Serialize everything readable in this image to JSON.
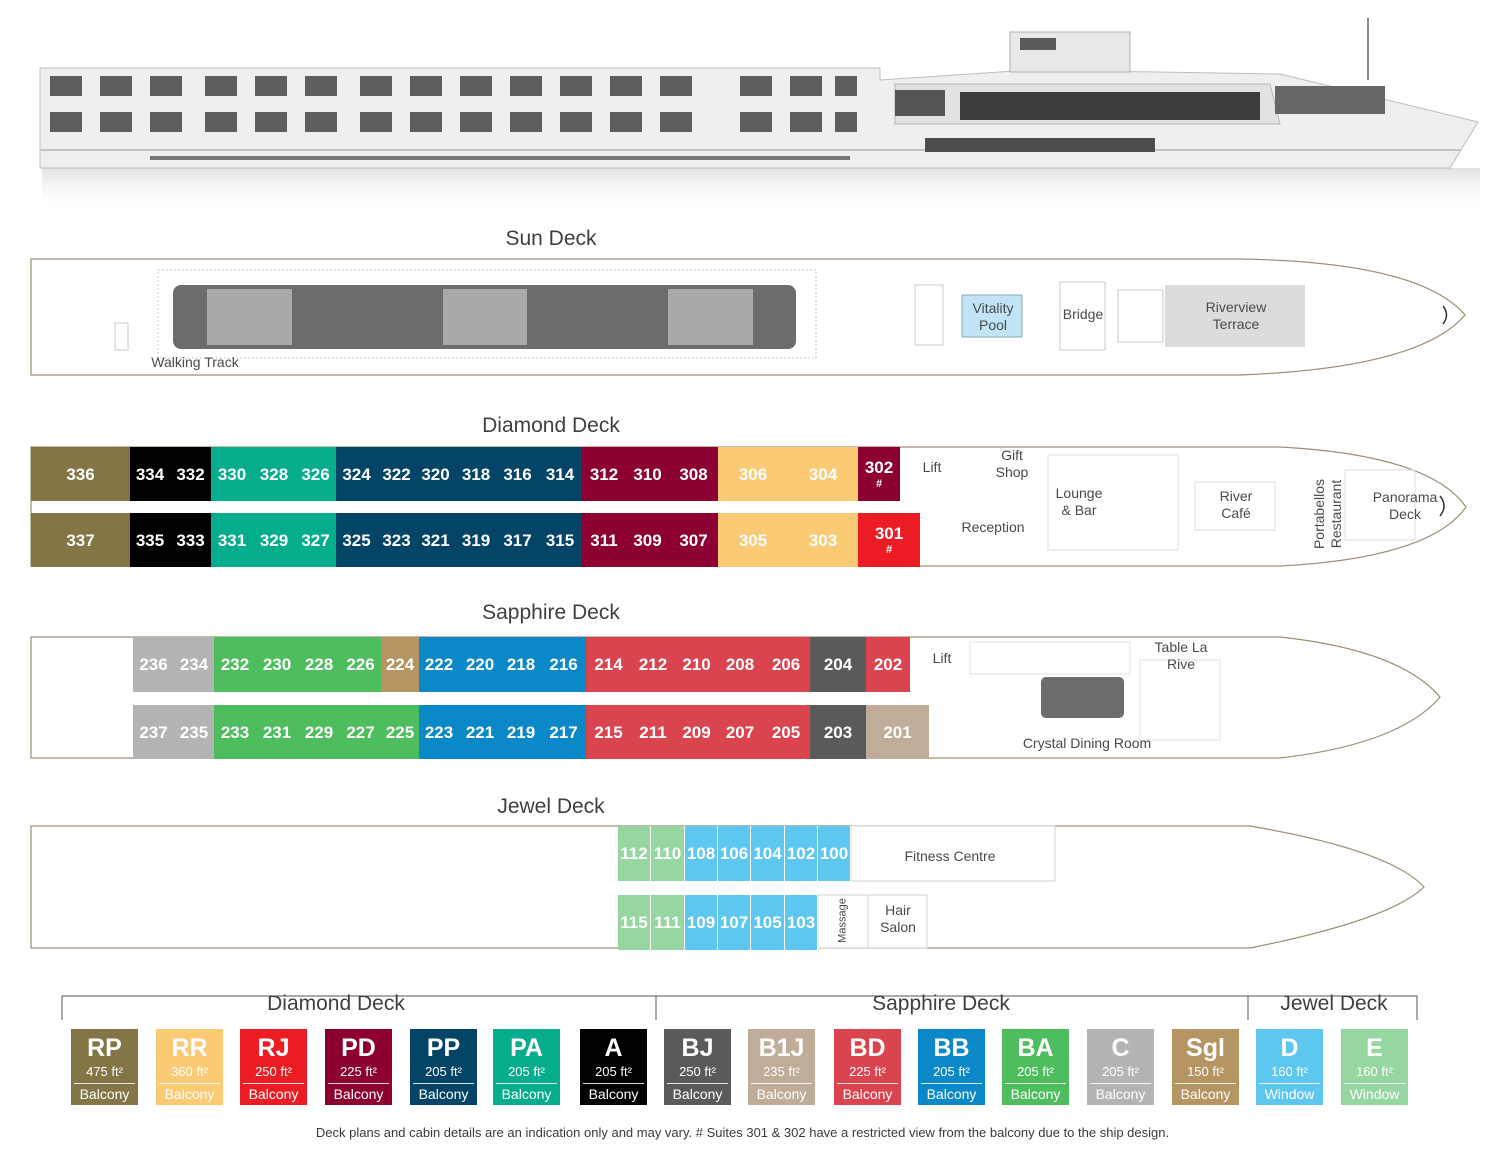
{
  "decks": {
    "sun": {
      "title": "Sun Deck",
      "walking_track": "Walking Track",
      "vitality_pool": "Vitality Pool",
      "bridge": "Bridge",
      "riverview_terrace": "Riverview Terrace"
    },
    "diamond": {
      "title": "Diamond Deck",
      "lift": "Lift",
      "gift_shop": "Gift Shop",
      "reception": "Reception",
      "lounge_bar": "Lounge & Bar",
      "river_cafe": "River Café",
      "portabellos": "Portabellos Restaurant",
      "panorama_deck": "Panorama Deck",
      "top_cabins": [
        {
          "n": "336",
          "cat": "RP"
        },
        {
          "n": "334",
          "cat": "A"
        },
        {
          "n": "332",
          "cat": "A"
        },
        {
          "n": "330",
          "cat": "PA"
        },
        {
          "n": "328",
          "cat": "PA"
        },
        {
          "n": "326",
          "cat": "PA"
        },
        {
          "n": "324",
          "cat": "PP"
        },
        {
          "n": "322",
          "cat": "PP"
        },
        {
          "n": "320",
          "cat": "PP"
        },
        {
          "n": "318",
          "cat": "PP"
        },
        {
          "n": "316",
          "cat": "PP"
        },
        {
          "n": "314",
          "cat": "PP"
        },
        {
          "n": "312",
          "cat": "PD"
        },
        {
          "n": "310",
          "cat": "PD"
        },
        {
          "n": "308",
          "cat": "PD"
        },
        {
          "n": "306",
          "cat": "RR"
        },
        {
          "n": "304",
          "cat": "RR"
        },
        {
          "n": "302",
          "cat": "PD",
          "mark": "#"
        }
      ],
      "bottom_cabins": [
        {
          "n": "337",
          "cat": "RP"
        },
        {
          "n": "335",
          "cat": "A"
        },
        {
          "n": "333",
          "cat": "A"
        },
        {
          "n": "331",
          "cat": "PA"
        },
        {
          "n": "329",
          "cat": "PA"
        },
        {
          "n": "327",
          "cat": "PA"
        },
        {
          "n": "325",
          "cat": "PP"
        },
        {
          "n": "323",
          "cat": "PP"
        },
        {
          "n": "321",
          "cat": "PP"
        },
        {
          "n": "319",
          "cat": "PP"
        },
        {
          "n": "317",
          "cat": "PP"
        },
        {
          "n": "315",
          "cat": "PP"
        },
        {
          "n": "311",
          "cat": "PD"
        },
        {
          "n": "309",
          "cat": "PD"
        },
        {
          "n": "307",
          "cat": "PD"
        },
        {
          "n": "305",
          "cat": "RR"
        },
        {
          "n": "303",
          "cat": "RR"
        },
        {
          "n": "301",
          "cat": "RJ",
          "mark": "#"
        }
      ]
    },
    "sapphire": {
      "title": "Sapphire Deck",
      "lift": "Lift",
      "table_la_rive": "Table La Rive",
      "crystal_dining": "Crystal Dining Room",
      "top_cabins": [
        {
          "n": "236",
          "cat": "C"
        },
        {
          "n": "234",
          "cat": "C"
        },
        {
          "n": "232",
          "cat": "BA"
        },
        {
          "n": "230",
          "cat": "BA"
        },
        {
          "n": "228",
          "cat": "BA"
        },
        {
          "n": "226",
          "cat": "BA"
        },
        {
          "n": "224",
          "cat": "Sgl"
        },
        {
          "n": "222",
          "cat": "BB"
        },
        {
          "n": "220",
          "cat": "BB"
        },
        {
          "n": "218",
          "cat": "BB"
        },
        {
          "n": "216",
          "cat": "BB"
        },
        {
          "n": "214",
          "cat": "BD"
        },
        {
          "n": "212",
          "cat": "BD"
        },
        {
          "n": "210",
          "cat": "BD"
        },
        {
          "n": "208",
          "cat": "BD"
        },
        {
          "n": "206",
          "cat": "BD"
        },
        {
          "n": "204",
          "cat": "BJ"
        },
        {
          "n": "202",
          "cat": "BD"
        }
      ],
      "bottom_cabins": [
        {
          "n": "237",
          "cat": "C"
        },
        {
          "n": "235",
          "cat": "C"
        },
        {
          "n": "233",
          "cat": "BA"
        },
        {
          "n": "231",
          "cat": "BA"
        },
        {
          "n": "229",
          "cat": "BA"
        },
        {
          "n": "227",
          "cat": "BA"
        },
        {
          "n": "225",
          "cat": "BA"
        },
        {
          "n": "223",
          "cat": "BB"
        },
        {
          "n": "221",
          "cat": "BB"
        },
        {
          "n": "219",
          "cat": "BB"
        },
        {
          "n": "217",
          "cat": "BB"
        },
        {
          "n": "215",
          "cat": "BD"
        },
        {
          "n": "211",
          "cat": "BD"
        },
        {
          "n": "209",
          "cat": "BD"
        },
        {
          "n": "207",
          "cat": "BD"
        },
        {
          "n": "205",
          "cat": "BD"
        },
        {
          "n": "203",
          "cat": "BJ"
        },
        {
          "n": "201",
          "cat": "B1J"
        }
      ]
    },
    "jewel": {
      "title": "Jewel Deck",
      "fitness_centre": "Fitness Centre",
      "massage": "Massage",
      "hair_salon": "Hair Salon",
      "top_cabins": [
        {
          "n": "112",
          "cat": "E"
        },
        {
          "n": "110",
          "cat": "E"
        },
        {
          "n": "108",
          "cat": "D"
        },
        {
          "n": "106",
          "cat": "D"
        },
        {
          "n": "104",
          "cat": "D"
        },
        {
          "n": "102",
          "cat": "D"
        },
        {
          "n": "100",
          "cat": "D"
        }
      ],
      "bottom_cabins": [
        {
          "n": "115",
          "cat": "E"
        },
        {
          "n": "111",
          "cat": "E"
        },
        {
          "n": "109",
          "cat": "D"
        },
        {
          "n": "107",
          "cat": "D"
        },
        {
          "n": "105",
          "cat": "D"
        },
        {
          "n": "103",
          "cat": "D"
        }
      ]
    }
  },
  "legend": {
    "diamond_title": "Diamond Deck",
    "sapphire_title": "Sapphire Deck",
    "jewel_title": "Jewel Deck",
    "categories": [
      {
        "code": "RP",
        "size": "475 ft²",
        "type": "Balcony",
        "color": "#837545"
      },
      {
        "code": "RR",
        "size": "360 ft²",
        "type": "Balcony",
        "color": "#fbca75"
      },
      {
        "code": "RJ",
        "size": "250 ft²",
        "type": "Balcony",
        "color": "#ec1c24"
      },
      {
        "code": "PD",
        "size": "225 ft²",
        "type": "Balcony",
        "color": "#8c0032"
      },
      {
        "code": "PP",
        "size": "205 ft²",
        "type": "Balcony",
        "color": "#044466"
      },
      {
        "code": "PA",
        "size": "205 ft²",
        "type": "Balcony",
        "color": "#06ad8d"
      },
      {
        "code": "A",
        "size": "205 ft²",
        "type": "Balcony",
        "color": "#000000"
      },
      {
        "code": "BJ",
        "size": "250 ft²",
        "type": "Balcony",
        "color": "#5a5a5a"
      },
      {
        "code": "B1J",
        "size": "235 ft²",
        "type": "Balcony",
        "color": "#bfac99"
      },
      {
        "code": "BD",
        "size": "225 ft²",
        "type": "Balcony",
        "color": "#d9444f"
      },
      {
        "code": "BB",
        "size": "205 ft²",
        "type": "Balcony",
        "color": "#0a88c8"
      },
      {
        "code": "BA",
        "size": "205 ft²",
        "type": "Balcony",
        "color": "#4dbd5e"
      },
      {
        "code": "C",
        "size": "205 ft²",
        "type": "Balcony",
        "color": "#b4b4b4"
      },
      {
        "code": "Sgl",
        "size": "150 ft²",
        "type": "Balcony",
        "color": "#b59561"
      },
      {
        "code": "D",
        "size": "160 ft²",
        "type": "Window",
        "color": "#5ec7ef"
      },
      {
        "code": "E",
        "size": "160 ft²",
        "type": "Window",
        "color": "#95d6a1"
      }
    ]
  },
  "footnote": "Deck plans and cabin details are an indication only and may vary.  # Suites 301 & 302 have a restricted view from the balcony due to the ship design."
}
